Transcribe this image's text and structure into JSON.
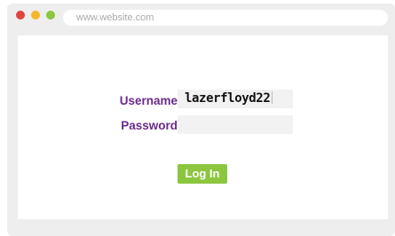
{
  "browser": {
    "url": "www.website.com",
    "controls": {
      "close_color": "#e0443e",
      "minimize_color": "#f5b629",
      "maximize_color": "#8cc63f"
    }
  },
  "login_form": {
    "username_label": "Username",
    "username_value": "lazerfloyd22",
    "password_label": "Password",
    "password_value": "",
    "submit_label": "Log In"
  },
  "colors": {
    "label_color": "#6a2a8c",
    "button_color": "#8cc63f"
  }
}
